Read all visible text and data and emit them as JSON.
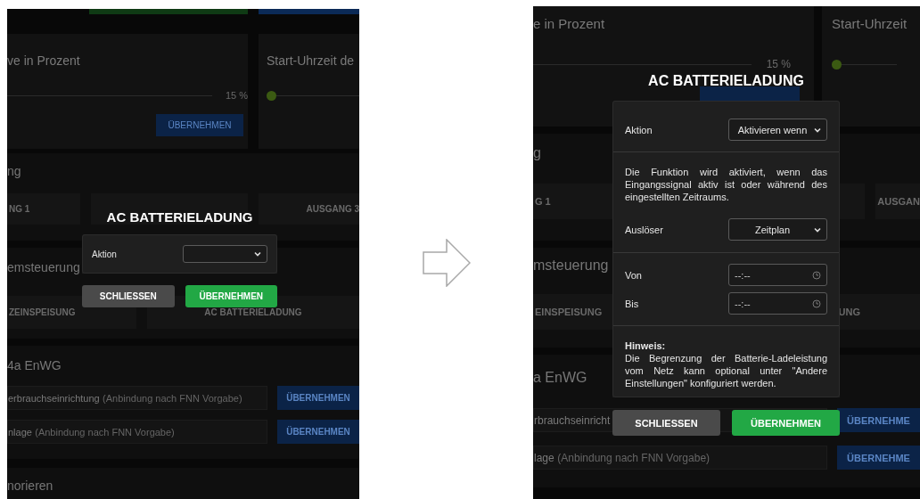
{
  "screens": [
    {
      "background": {
        "top_buttons": [
          {
            "kind": "success"
          },
          {
            "kind": "primary"
          }
        ],
        "cards": [
          {
            "title": "ve in Prozent",
            "reading": "15 %",
            "button": {
              "kind": "text",
              "label": "ÜBERNEHMEN"
            }
          },
          {
            "title": "Start-Uhrzeit de",
            "thumb": {
              "level": 0
            }
          }
        ],
        "sections": [
          {
            "title": "ng",
            "tiles": [
              {
                "kind": "text",
                "label": "NG 1"
              },
              {
                "kind": "blank"
              },
              {
                "kind": "text",
                "label": "AUSGANG 3"
              }
            ]
          },
          {
            "title": "emsteuerung",
            "tiles": [
              {
                "kind": "text",
                "label": "ZEINSPEISUNG"
              },
              {
                "kind": "text",
                "label": "AC BATTERIELADUNG"
              }
            ]
          },
          {
            "title": "4a EnWG",
            "rows": [
              {
                "field": {
                  "label": "erbrauchseinrichtung",
                  "hint": "(Anbindung nach FNN Vorgabe)"
                },
                "button": "ÜBERNEHMEN"
              },
              {
                "field": {
                  "label": "nlage",
                  "hint": "(Anbindung nach FNN Vorgabe)"
                },
                "button": "ÜBERNEHMEN"
              }
            ]
          },
          {
            "title": "norieren"
          }
        ]
      },
      "dialog": {
        "title": "AC BATTERIELADUNG",
        "groups": [
          [
            {
              "kind": "select",
              "label": "Aktion"
            }
          ]
        ],
        "buttons": [
          {
            "kind": "secondary",
            "label": "SCHLIESSEN"
          },
          {
            "kind": "primary",
            "label": "ÜBERNEHMEN"
          }
        ]
      }
    },
    {
      "background": {
        "cards": [
          {
            "title": "e in Prozent",
            "reading": "15 %",
            "button": {
              "kind": "blank"
            }
          },
          {
            "title": "Start-Uhrzeit",
            "thumb": {
              "level": 0
            }
          }
        ],
        "sections": [
          {
            "title": "g",
            "tiles": [
              {
                "kind": "text",
                "label": "G 1"
              },
              {
                "kind": "blank"
              },
              {
                "kind": "text",
                "label": "AUSGAN"
              }
            ]
          },
          {
            "title": "msteuerung",
            "tiles": [
              {
                "kind": "text",
                "label": "EINSPEISUNG"
              },
              {
                "kind": "text",
                "label": "UNG"
              }
            ]
          },
          {
            "title": "a EnWG",
            "rows": [
              {
                "field": {
                  "label": "rbrauchseinricht"
                },
                "button": "ÜBERNEHME"
              },
              {
                "field": {
                  "label": "lage",
                  "hint": "(Anbindung nach FNN Vorgabe)"
                },
                "button": "ÜBERNEHME"
              }
            ]
          }
        ]
      },
      "dialog": {
        "title": "AC BATTERIELADUNG",
        "groups": [
          [
            {
              "kind": "select",
              "label": "Aktion",
              "value": "Aktivieren wenn"
            }
          ],
          [
            {
              "kind": "text",
              "text": "Die Funktion wird aktiviert, wenn das Eingangssignal aktiv ist oder während des eingestellten Zeitraums."
            },
            {
              "kind": "select",
              "label": "Auslöser",
              "value": "Zeitplan"
            }
          ],
          [
            {
              "kind": "time",
              "label": "Von",
              "placeholder": "--:--"
            },
            {
              "kind": "time",
              "label": "Bis",
              "placeholder": "--:--"
            }
          ],
          [
            {
              "kind": "note",
              "heading": "Hinweis:",
              "text": "Die Begrenzung der Batterie-Ladeleistung vom Netz kann optional unter \"Andere Einstellungen\" konfiguriert werden."
            }
          ]
        ],
        "buttons": [
          {
            "kind": "secondary",
            "label": "SCHLIESSEN"
          },
          {
            "kind": "primary",
            "label": "ÜBERNEHMEN"
          }
        ]
      }
    }
  ]
}
